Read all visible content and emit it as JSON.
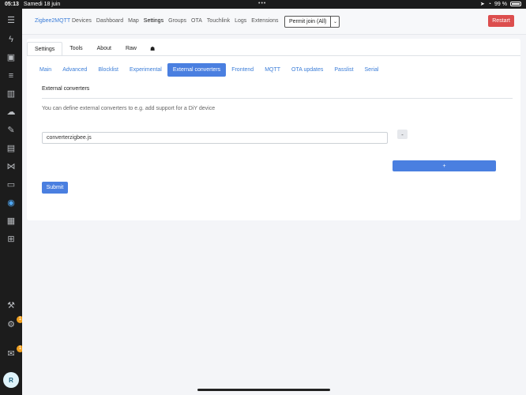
{
  "status": {
    "time": "05:13",
    "date": "Samedi 18 juin",
    "dots": "•••",
    "battery": "99 %"
  },
  "sidebar": {
    "icons": [
      "menu-icon",
      "lightning-icon",
      "dashboard-icon",
      "list-icon",
      "chart-icon",
      "cloud-icon",
      "wrench-icon",
      "device-icon",
      "vscode-icon",
      "terminal-icon",
      "zigbee-icon",
      "media-icon",
      "store-icon",
      "hammer-icon",
      "gear-icon",
      "notification-icon"
    ],
    "gear_badge": "1",
    "notification_badge": "1",
    "avatar": "R"
  },
  "navbar": {
    "brand": "Zigbee2MQTT",
    "links": [
      "Devices",
      "Dashboard",
      "Map",
      "Settings",
      "Groups",
      "OTA",
      "Touchlink",
      "Logs",
      "Extensions"
    ],
    "permit_join": "Permit join (All)",
    "restart": "Restart"
  },
  "tabs": [
    "Settings",
    "Tools",
    "About",
    "Raw"
  ],
  "subtabs": [
    "Main",
    "Advanced",
    "Blocklist",
    "Experimental",
    "External converters",
    "Frontend",
    "MQTT",
    "OTA updates",
    "Passlist",
    "Serial"
  ],
  "section": {
    "title": "External converters",
    "description": "You can define external converters to e.g. add support for a DiY device",
    "input_value": "converterzigbee.js",
    "minus_label": "-",
    "plus_label": "+",
    "submit_label": "Submit"
  }
}
